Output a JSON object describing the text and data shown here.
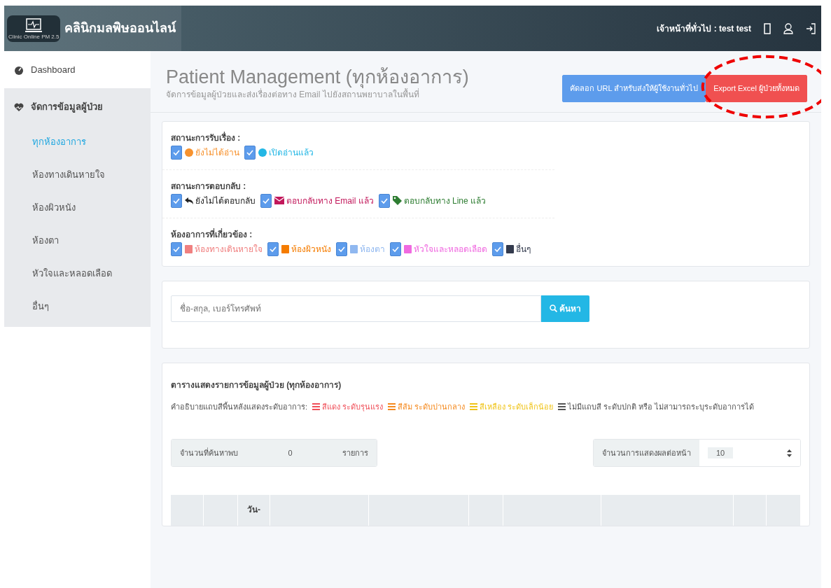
{
  "brand": {
    "name": "คลินิกมลพิษออนไลน์",
    "logo_caption": "Clinic Online PM 2.5"
  },
  "topbar": {
    "user": "เจ้าหน้าที่ทั่วไป : test test"
  },
  "sidebar": {
    "items": [
      {
        "label": "Dashboard"
      },
      {
        "label": "จัดการข้อมูลผู้ป่วย",
        "expanded": true,
        "children": [
          {
            "label": "ทุกห้องอาการ",
            "selected": true
          },
          {
            "label": "ห้องทางเดินหายใจ",
            "selected": false
          },
          {
            "label": "ห้องผิวหนัง",
            "selected": false
          },
          {
            "label": "ห้องตา",
            "selected": false
          },
          {
            "label": "หัวใจและหลอดเลือด",
            "selected": false
          },
          {
            "label": "อื่นๆ",
            "selected": false
          }
        ]
      }
    ]
  },
  "header": {
    "title": "Patient Management (ทุกห้องอาการ)",
    "subtitle": "จัดการข้อมูลผู้ป่วยและส่งเรื่องต่อทาง Email ไปยังสถานพยาบาลในพื้นที่",
    "buttons": [
      {
        "label": "คัดลอก URL สำหรับส่งให้ผู้ใช้งานทั่วไป",
        "kind": "primary"
      },
      {
        "label": "Export Excel ผู้ป่วยทั้งหมด",
        "kind": "danger",
        "highlighted": true
      }
    ]
  },
  "filters": [
    {
      "label": "สถานะการรับเรื่อง :",
      "options": [
        {
          "label": "ยังไม่ได้อ่าน",
          "checked": true,
          "kind": "dot",
          "color": "#f7922e"
        },
        {
          "label": "เปิดอ่านแล้ว",
          "checked": true,
          "kind": "dot",
          "color": "#23b7e5"
        }
      ]
    },
    {
      "label": "สถานะการตอบกลับ :",
      "options": [
        {
          "label": "ยังไม่ได้ตอบกลับ",
          "checked": true,
          "kind": "reply",
          "color": "#222222"
        },
        {
          "label": "ตอบกลับทาง Email แล้ว",
          "checked": true,
          "kind": "envelope",
          "color": "#c2185b"
        },
        {
          "label": "ตอบกลับทาง Line แล้ว",
          "checked": true,
          "kind": "tag",
          "color": "#2e7d32"
        }
      ]
    },
    {
      "label": "ห้องอาการที่เกี่ยวข้อง :",
      "options": [
        {
          "label": "ห้องทางเดินหายใจ",
          "checked": true,
          "kind": "square",
          "color": "#f08080"
        },
        {
          "label": "ห้องผิวหนัง",
          "checked": true,
          "kind": "square",
          "color": "#f57c00"
        },
        {
          "label": "ห้องตา",
          "checked": true,
          "kind": "square",
          "color": "#90b8f0"
        },
        {
          "label": "หัวใจและหลอดเลือด",
          "checked": true,
          "kind": "square",
          "color": "#f06ae0"
        },
        {
          "label": "อื่นๆ",
          "checked": true,
          "kind": "square",
          "color": "#333a4d"
        }
      ]
    }
  ],
  "search": {
    "placeholder": "ชื่อ-สกุล, เบอร์โทรศัพท์",
    "button": "ค้นหา"
  },
  "results": {
    "title": "ตารางแสดงรายการข้อมูลผู้ป่วย (ทุกห้องอาการ)",
    "legend_label": "คำอธิบายแถบสีพื้นหลังแสดงระดับอาการ:",
    "legend": [
      {
        "label": "สีแดง ระดับรุนแรง",
        "color": "#f0505a"
      },
      {
        "label": "สีส้ม ระดับปานกลาง",
        "color": "#f58a1f"
      },
      {
        "label": "สีเหลือง ระดับเล็กน้อย",
        "color": "#f0c419"
      },
      {
        "label": "ไม่มีแถบสี ระดับปกติ หรือ ไม่สามารถระบุระดับอาการได้",
        "color": "#555555"
      }
    ],
    "count_label": "จำนวนที่ค้นหาพบ",
    "count": "0",
    "count_unit": "รายการ",
    "per_page_label": "จำนวนการแสดงผลต่อหน้า",
    "per_page": "10",
    "table": {
      "header_text": "วัน-"
    }
  }
}
